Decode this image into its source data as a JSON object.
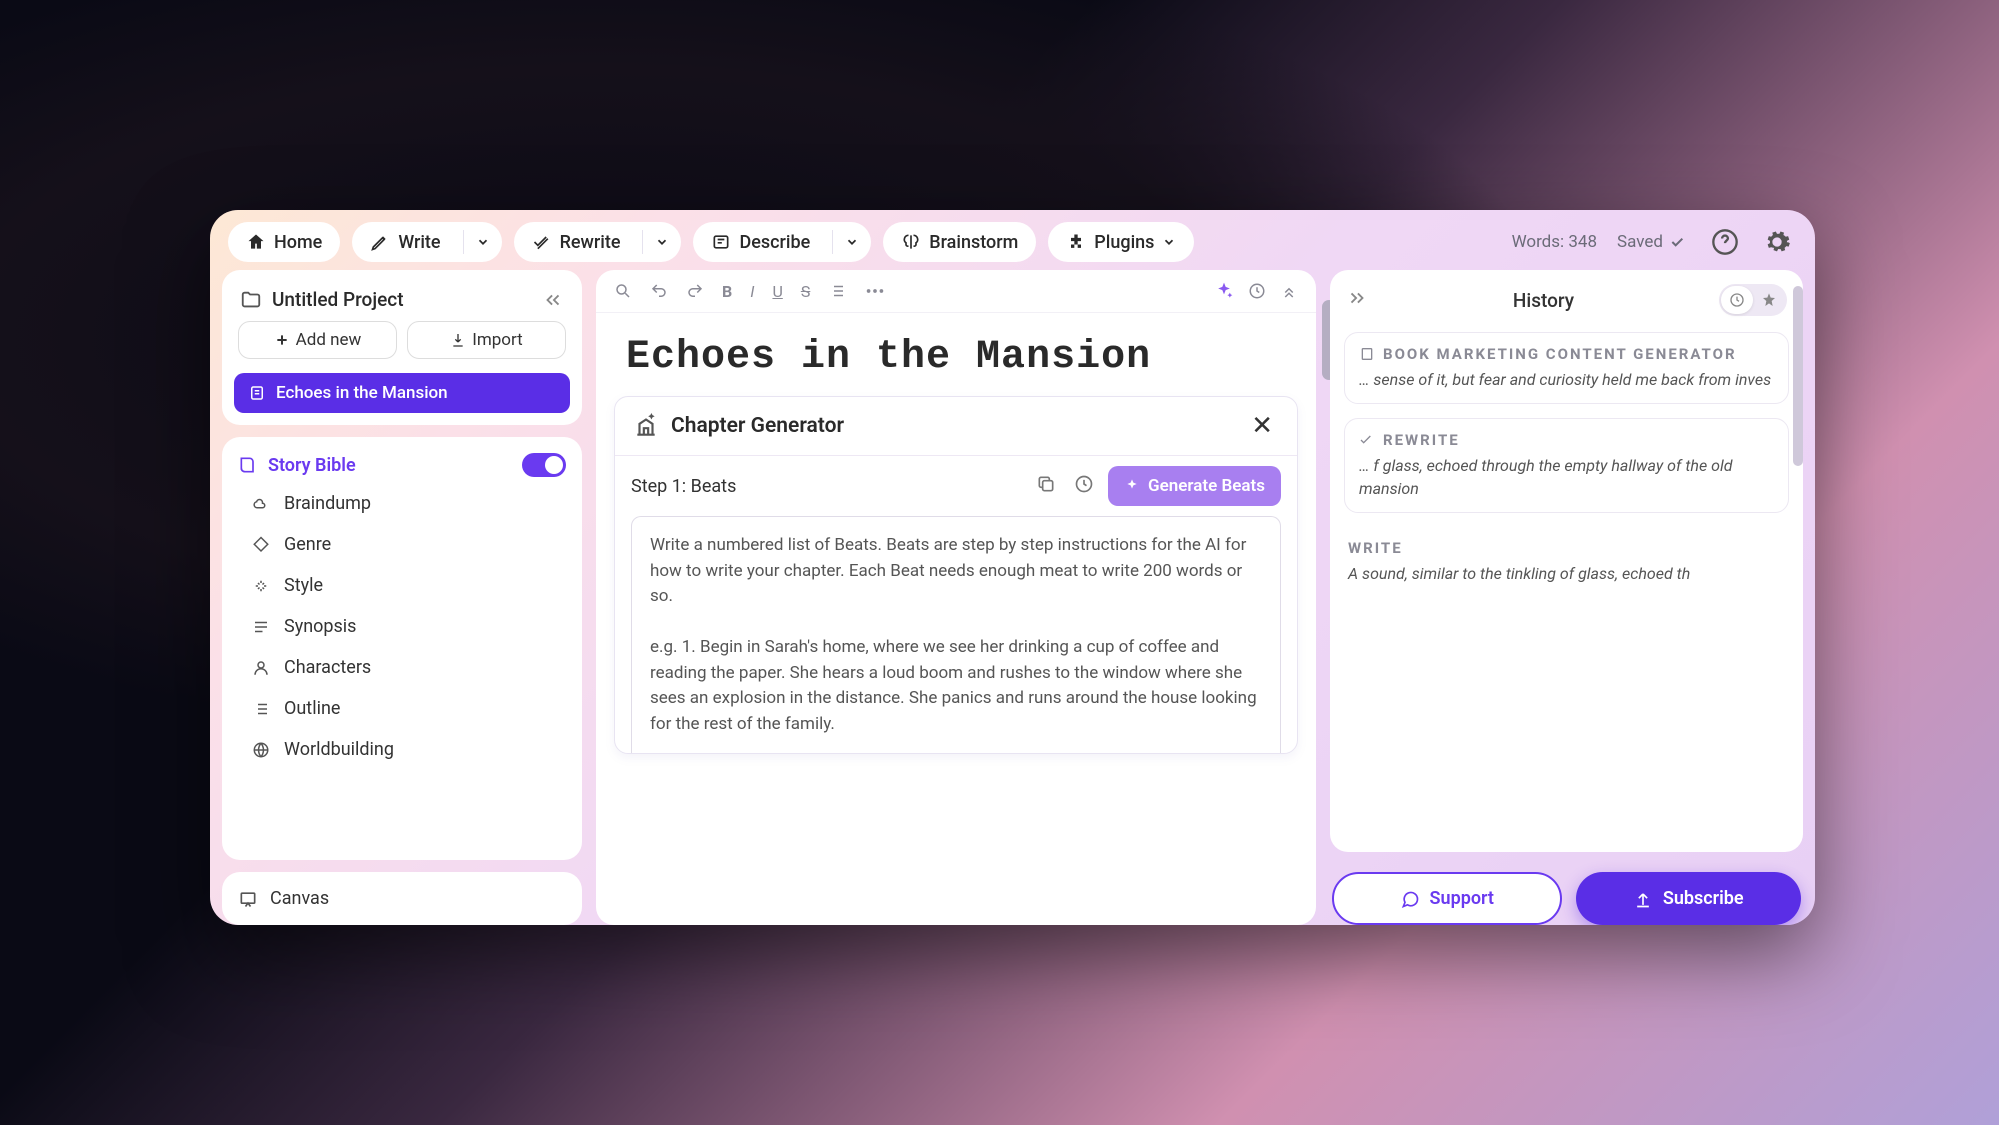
{
  "toolbar": {
    "home": "Home",
    "write": "Write",
    "rewrite": "Rewrite",
    "describe": "Describe",
    "brainstorm": "Brainstorm",
    "plugins": "Plugins",
    "words_label": "Words: 348",
    "saved_label": "Saved"
  },
  "sidebar": {
    "project_title": "Untitled Project",
    "add_new": "Add new",
    "import": "Import",
    "doc_title": "Echoes in the Mansion",
    "story_bible": "Story Bible",
    "items": [
      {
        "label": "Braindump"
      },
      {
        "label": "Genre"
      },
      {
        "label": "Style"
      },
      {
        "label": "Synopsis"
      },
      {
        "label": "Characters"
      },
      {
        "label": "Outline"
      },
      {
        "label": "Worldbuilding"
      }
    ],
    "canvas": "Canvas"
  },
  "editor": {
    "title": "Echoes in the Mansion",
    "chapter_gen_title": "Chapter Generator",
    "step_label": "Step 1: Beats",
    "generate_beats": "Generate Beats",
    "beats_placeholder": "Write a numbered list of Beats. Beats are step by step instructions for the AI for how to write your chapter. Each Beat needs enough meat to write 200 words or so.\n\ne.g. 1. Begin in Sarah's home, where we see her drinking a cup of coffee and reading the paper. She hears a loud boom and rushes to the window where she sees an explosion in the distance. She panics and runs around the house looking for the rest of the family."
  },
  "history": {
    "title": "History",
    "items": [
      {
        "label": "BOOK MARKETING CONTENT GENERATOR",
        "snippet": "… sense of it, but fear and curiosity held me back from inves"
      },
      {
        "label": "REWRITE",
        "snippet": "… f glass, echoed through the empty hallway of the old mansion"
      },
      {
        "label": "WRITE",
        "snippet": "A sound, similar to the tinkling of glass, echoed th"
      }
    ],
    "support": "Support",
    "subscribe": "Subscribe"
  }
}
